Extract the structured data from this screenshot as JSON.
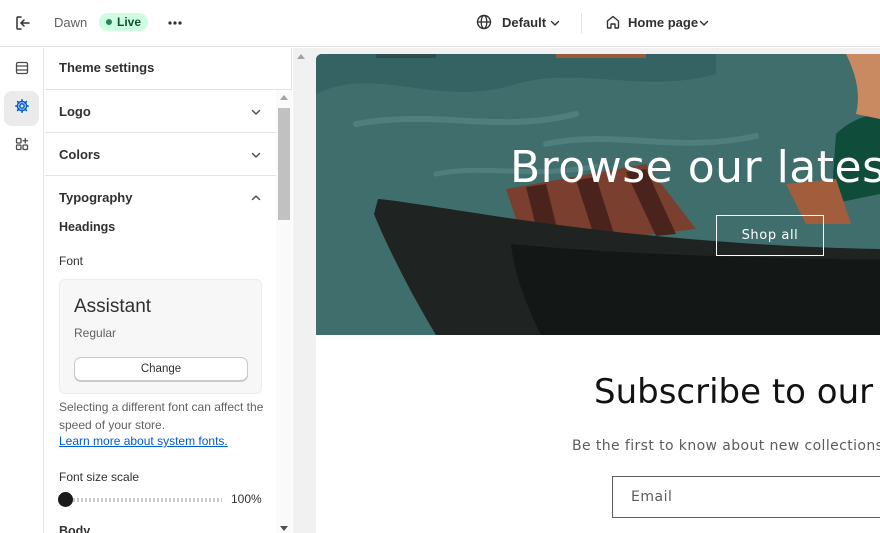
{
  "topbar": {
    "theme_name": "Dawn",
    "status_badge": "Live",
    "locale": "Default",
    "template": "Home page"
  },
  "rail": {
    "items": [
      {
        "name": "sections",
        "icon": "sections-icon",
        "active": false
      },
      {
        "name": "theme-settings",
        "icon": "gear-icon",
        "active": true
      },
      {
        "name": "app-embeds",
        "icon": "apps-icon",
        "active": false
      }
    ]
  },
  "panel": {
    "title": "Theme settings",
    "sections": [
      {
        "label": "Logo",
        "expanded": false
      },
      {
        "label": "Colors",
        "expanded": false
      },
      {
        "label": "Typography",
        "expanded": true
      }
    ],
    "typography": {
      "headings_label": "Headings",
      "font_label": "Font",
      "font_name": "Assistant",
      "font_style": "Regular",
      "change_label": "Change",
      "help_text": "Selecting a different font can affect the speed of your store.",
      "help_link": "Learn more about system fonts.",
      "scale_label": "Font size scale",
      "scale_value": "100%",
      "scale_fraction": 0.0,
      "body_label": "Body"
    }
  },
  "preview": {
    "hero_title": "Browse our latest p",
    "hero_button": "Shop all",
    "subscribe_title": "Subscribe to our en",
    "subscribe_text": "Be the first to know about new collections and ex",
    "email_placeholder": "Email"
  },
  "colors": {
    "accent": "#005bd3",
    "live_badge_bg": "#cdfee1",
    "live_badge_text": "#0c5132",
    "hero_bg": "#3d6b6b"
  }
}
